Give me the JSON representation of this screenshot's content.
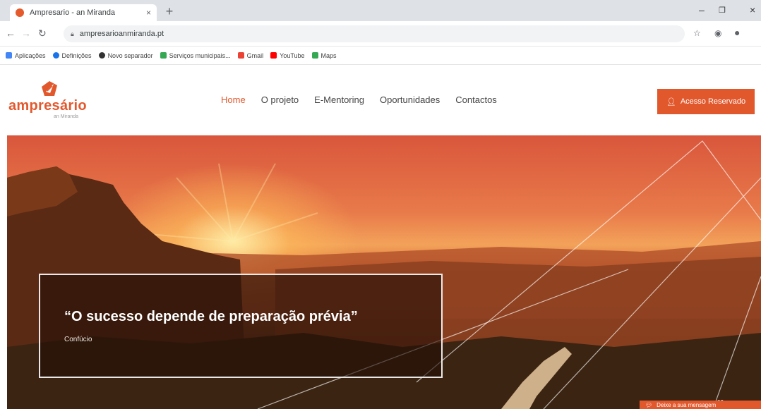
{
  "browser": {
    "tab_title": "Ampresario - an Miranda",
    "new_tab_symbol": "+",
    "close_symbol": "×",
    "url": "ampresarioanmiranda.pt",
    "win_min": "–",
    "win_max": "❐",
    "win_close": "×",
    "bookmarks": [
      {
        "label": "Aplicações",
        "color": "#4285f4"
      },
      {
        "label": "Definições",
        "color": "#1a73e8"
      },
      {
        "label": "Novo separador",
        "color": "#333333"
      },
      {
        "label": "Serviços municipais...",
        "color": "#34a853"
      },
      {
        "label": "Gmail",
        "color": "#ea4335"
      },
      {
        "label": "YouTube",
        "color": "#ff0000"
      },
      {
        "label": "Maps",
        "color": "#34a853"
      }
    ]
  },
  "site": {
    "logo_text": "ampresário",
    "logo_sub": "an Miranda",
    "nav": [
      "Home",
      "O projeto",
      "E-Mentoring",
      "Oportunidades",
      "Contactos"
    ],
    "active_nav": "Home",
    "access_button": "Acesso Reservado",
    "accent_color": "#e2582d"
  },
  "hero": {
    "quote": "“O sucesso depende de preparação prévia”",
    "author": "Confúcio",
    "slide_counter": "02",
    "chat_button": "Deixe a sua mensagem"
  }
}
